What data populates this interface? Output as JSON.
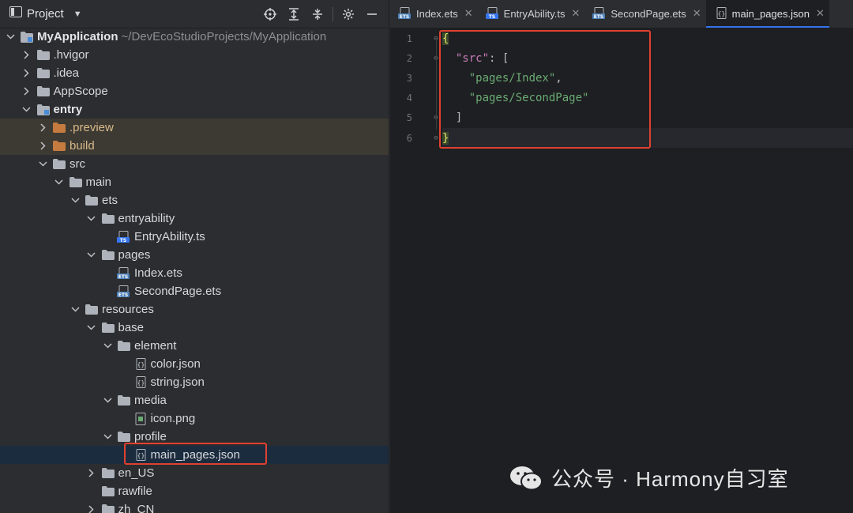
{
  "project_panel": {
    "title": "Project",
    "tools": [
      "locate-icon",
      "expand-all-icon",
      "collapse-all-icon",
      "gear-icon",
      "hide-icon"
    ]
  },
  "tree": [
    {
      "label": "MyApplication",
      "path": "~/DevEcoStudioProjects/MyApplication",
      "depth": 0,
      "arrow": "down",
      "icon": "module",
      "bold": true
    },
    {
      "label": ".hvigor",
      "depth": 1,
      "arrow": "right",
      "icon": "folder"
    },
    {
      "label": ".idea",
      "depth": 1,
      "arrow": "right",
      "icon": "folder"
    },
    {
      "label": "AppScope",
      "depth": 1,
      "arrow": "right",
      "icon": "folder"
    },
    {
      "label": "entry",
      "depth": 1,
      "arrow": "down",
      "icon": "module",
      "bold": true
    },
    {
      "label": ".preview",
      "depth": 2,
      "arrow": "right",
      "icon": "folder-orange",
      "excluded": true
    },
    {
      "label": "build",
      "depth": 2,
      "arrow": "right",
      "icon": "folder-orange",
      "excluded": true
    },
    {
      "label": "src",
      "depth": 2,
      "arrow": "down",
      "icon": "folder"
    },
    {
      "label": "main",
      "depth": 3,
      "arrow": "down",
      "icon": "folder"
    },
    {
      "label": "ets",
      "depth": 4,
      "arrow": "down",
      "icon": "folder"
    },
    {
      "label": "entryability",
      "depth": 5,
      "arrow": "down",
      "icon": "folder"
    },
    {
      "label": "EntryAbility.ts",
      "depth": 6,
      "arrow": "",
      "icon": "ts-file"
    },
    {
      "label": "pages",
      "depth": 5,
      "arrow": "down",
      "icon": "folder"
    },
    {
      "label": "Index.ets",
      "depth": 6,
      "arrow": "",
      "icon": "ets-file"
    },
    {
      "label": "SecondPage.ets",
      "depth": 6,
      "arrow": "",
      "icon": "ets-file"
    },
    {
      "label": "resources",
      "depth": 4,
      "arrow": "down",
      "icon": "folder"
    },
    {
      "label": "base",
      "depth": 5,
      "arrow": "down",
      "icon": "folder"
    },
    {
      "label": "element",
      "depth": 6,
      "arrow": "down",
      "icon": "folder"
    },
    {
      "label": "color.json",
      "depth": 7,
      "arrow": "",
      "icon": "json-file"
    },
    {
      "label": "string.json",
      "depth": 7,
      "arrow": "",
      "icon": "json-file"
    },
    {
      "label": "media",
      "depth": 6,
      "arrow": "down",
      "icon": "folder"
    },
    {
      "label": "icon.png",
      "depth": 7,
      "arrow": "",
      "icon": "image-file"
    },
    {
      "label": "profile",
      "depth": 6,
      "arrow": "down",
      "icon": "folder"
    },
    {
      "label": "main_pages.json",
      "depth": 7,
      "arrow": "",
      "icon": "json-file",
      "selected": true
    },
    {
      "label": "en_US",
      "depth": 5,
      "arrow": "right",
      "icon": "folder"
    },
    {
      "label": "rawfile",
      "depth": 5,
      "arrow": "",
      "icon": "folder"
    },
    {
      "label": "zh_CN",
      "depth": 5,
      "arrow": "right",
      "icon": "folder"
    }
  ],
  "tabs": [
    {
      "label": "Index.ets",
      "icon": "ets-file",
      "active": false
    },
    {
      "label": "EntryAbility.ts",
      "icon": "ts-file",
      "active": false
    },
    {
      "label": "SecondPage.ets",
      "icon": "ets-file",
      "active": false
    },
    {
      "label": "main_pages.json",
      "icon": "json-file",
      "active": true
    }
  ],
  "editor": {
    "line_numbers": [
      "1",
      "2",
      "3",
      "4",
      "5",
      "6"
    ],
    "code": {
      "l1_brace": "{",
      "l2_key": "\"src\"",
      "l2_rest": ": [",
      "l3_str": "\"pages/Index\"",
      "l3_comma": ",",
      "l4_str": "\"pages/SecondPage\"",
      "l5_bracket": "]",
      "l6_brace": "}"
    }
  },
  "watermark": {
    "text": "公众号 · Harmony自习室"
  },
  "colors": {
    "highlight_box": "#e1412f",
    "accent": "#3574f0",
    "string": "#6aab73",
    "key": "#c77dbb"
  }
}
